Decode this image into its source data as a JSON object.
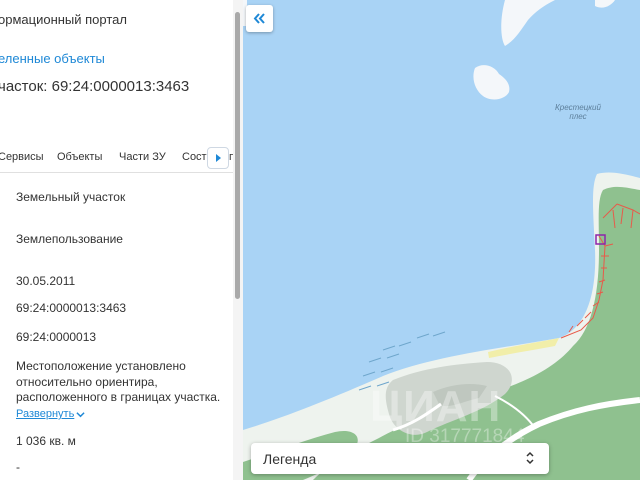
{
  "panel": {
    "portal_title": "ормационный портал",
    "selected_objects_link": "еленные объекты",
    "parcel_title": "часток: 69:24:0000013:3463",
    "tabs": [
      "Сервисы",
      "Объекты",
      "Части ЗУ",
      "Соста"
    ],
    "tab_partial": "п",
    "fields": {
      "object_type": "Земельный участок",
      "category": "Землепользование",
      "date": "30.05.2011",
      "cadastral_number": "69:24:0000013:3463",
      "quarter_number": "69:24:0000013",
      "location": "Местоположение установлено относительно ориентира, расположенного в границах участка.",
      "expand_link": "Развернуть",
      "area": "1 036 кв. м",
      "dash": "-"
    }
  },
  "map": {
    "water_label": "Крестецкий плес",
    "legend_label": "Легенда",
    "watermark_brand": "ЦИАН",
    "watermark_id": "ID 317771844",
    "colors": {
      "water": "#a9d3f5",
      "land": "#8fc18f",
      "road": "#ffffff",
      "parcel": "#e85a4a",
      "selected_parcel": "#8e24aa"
    }
  },
  "icons": {
    "collapse": "double-chevron-left-icon",
    "tab_scroll": "caret-right-icon",
    "expand": "chevron-down-icon",
    "legend_toggle": "sort-arrows-icon"
  }
}
